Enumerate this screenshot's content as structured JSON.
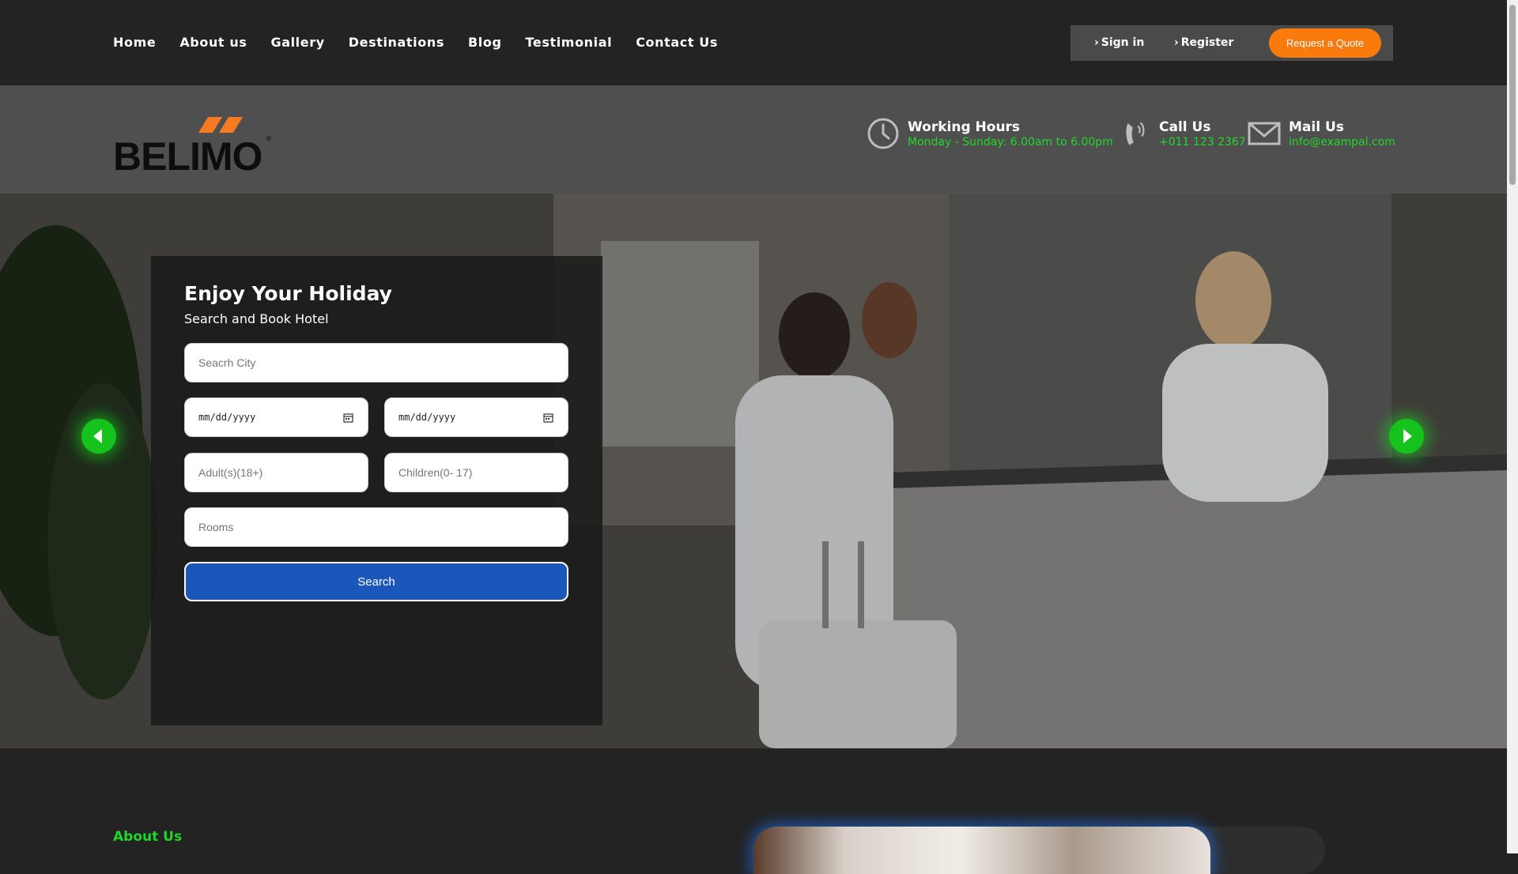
{
  "nav": {
    "items": [
      "Home",
      "About us",
      "Gallery",
      "Destinations",
      "Blog",
      "Testimonial",
      "Contact Us"
    ]
  },
  "auth": {
    "signin": "Sign in",
    "register": "Register",
    "quote": "Request a Quote"
  },
  "header": {
    "logo_text": "BELIMO",
    "hours_title": "Working Hours",
    "hours_value": "Monday - Sunday: 6.00am to 6.00pm",
    "call_title": "Call Us",
    "call_value": "+011 123 2367",
    "mail_title": "Mail Us",
    "mail_value": "info@exampal.com"
  },
  "booking": {
    "title": "Enjoy Your Holiday",
    "subtitle": "Search and Book Hotel",
    "city_placeholder": "Seacrh City",
    "checkin_placeholder": "mm/dd/yyyy",
    "checkout_placeholder": "mm/dd/yyyy",
    "adults_placeholder": "Adult(s)(18+)",
    "children_placeholder": "Children(0- 17)",
    "rooms_placeholder": "Rooms",
    "search_label": "Search"
  },
  "about": {
    "label": "About Us"
  },
  "colors": {
    "accent_green": "#22d629",
    "quote_orange": "#fb7a0c",
    "search_blue": "#1b56bb",
    "logo_orange": "#f47b20"
  }
}
